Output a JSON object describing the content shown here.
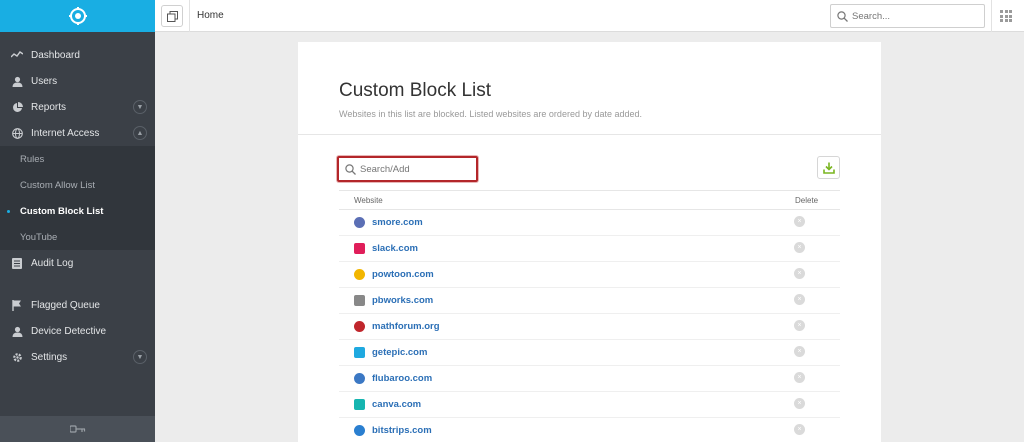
{
  "topbar": {
    "breadcrumb": "Home",
    "search_placeholder": "Search..."
  },
  "sidebar": {
    "items": [
      {
        "label": "Dashboard",
        "icon": "pulse-icon"
      },
      {
        "label": "Users",
        "icon": "user-icon"
      },
      {
        "label": "Reports",
        "icon": "pie-chart-icon",
        "expandable": true
      },
      {
        "label": "Internet Access",
        "icon": "globe-icon",
        "expandable": true,
        "expanded": true
      },
      {
        "label": "Audit Log",
        "icon": "list-icon"
      },
      {
        "label": "Flagged Queue",
        "icon": "flag-icon"
      },
      {
        "label": "Device Detective",
        "icon": "user-icon"
      },
      {
        "label": "Settings",
        "icon": "gear-icon",
        "expandable": true
      }
    ],
    "sub_items": [
      {
        "label": "Rules"
      },
      {
        "label": "Custom Allow List"
      },
      {
        "label": "Custom Block List",
        "active": true
      },
      {
        "label": "YouTube"
      }
    ]
  },
  "card": {
    "title": "Custom Block List",
    "subtitle": "Websites in this list are blocked. Listed websites are ordered by date added.",
    "search_placeholder": "Search/Add",
    "columns": {
      "website": "Website",
      "delete": "Delete"
    },
    "rows": [
      {
        "site": "smore.com",
        "favicon_color": "#5b6fb5"
      },
      {
        "site": "slack.com",
        "favicon_color": "#e01e5a"
      },
      {
        "site": "powtoon.com",
        "favicon_color": "#f2b600"
      },
      {
        "site": "pbworks.com",
        "favicon_color": "#888888"
      },
      {
        "site": "mathforum.org",
        "favicon_color": "#c0262c"
      },
      {
        "site": "getepic.com",
        "favicon_color": "#1fa9e0"
      },
      {
        "site": "flubaroo.com",
        "favicon_color": "#3b78c4"
      },
      {
        "site": "canva.com",
        "favicon_color": "#16b5b0"
      },
      {
        "site": "bitstrips.com",
        "favicon_color": "#2a7fd0"
      }
    ]
  },
  "colors": {
    "brand": "#19aee3",
    "sidebar": "#3b4047",
    "link": "#2b6fb6",
    "highlight": "#b3262a"
  }
}
